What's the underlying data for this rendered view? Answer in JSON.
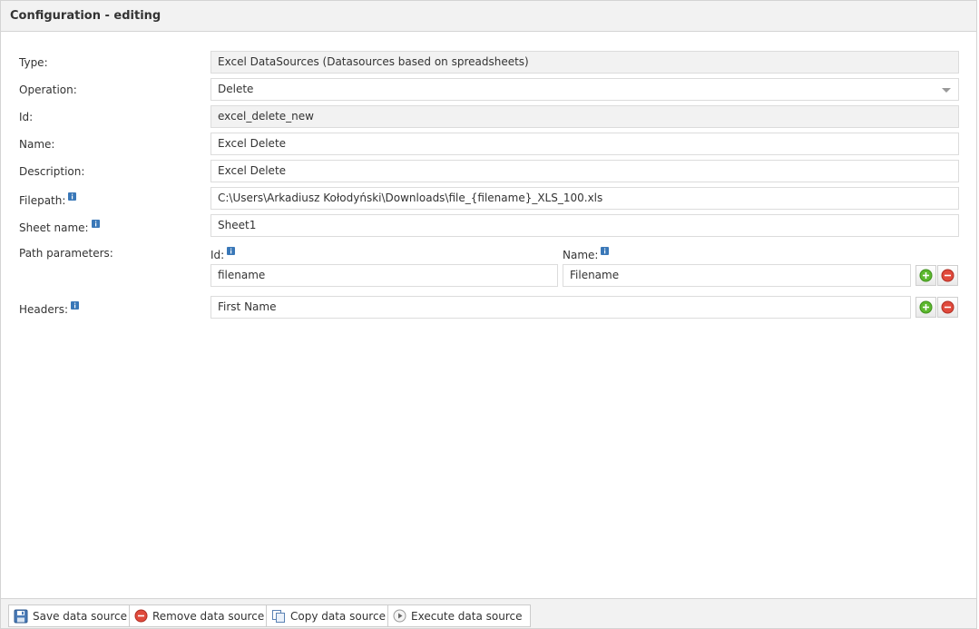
{
  "header": {
    "title": "Configuration - editing"
  },
  "form": {
    "type": {
      "label": "Type:",
      "value": "Excel DataSources (Datasources based on spreadsheets)"
    },
    "operation": {
      "label": "Operation:",
      "value": "Delete"
    },
    "id": {
      "label": "Id:",
      "value": "excel_delete_new"
    },
    "name": {
      "label": "Name:",
      "value": "Excel Delete"
    },
    "description": {
      "label": "Description:",
      "value": "Excel Delete"
    },
    "filepath": {
      "label": "Filepath:",
      "value": "C:\\Users\\Arkadiusz Kołodyński\\Downloads\\file_{filename}_XLS_100.xls"
    },
    "sheet_name": {
      "label": "Sheet name:",
      "value": "Sheet1"
    },
    "path_parameters": {
      "label": "Path parameters:",
      "id_label": "Id:",
      "name_label": "Name:",
      "rows": [
        {
          "id": "filename",
          "name": "Filename"
        }
      ]
    },
    "headers": {
      "label": "Headers:",
      "rows": [
        "First Name"
      ]
    }
  },
  "footer": {
    "save": "Save data source",
    "remove": "Remove data source",
    "copy": "Copy data source",
    "execute": "Execute data source"
  },
  "colors": {
    "info_icon": "#3a78b8",
    "add_icon": "#5cb82e",
    "remove_icon": "#e04a3c"
  }
}
